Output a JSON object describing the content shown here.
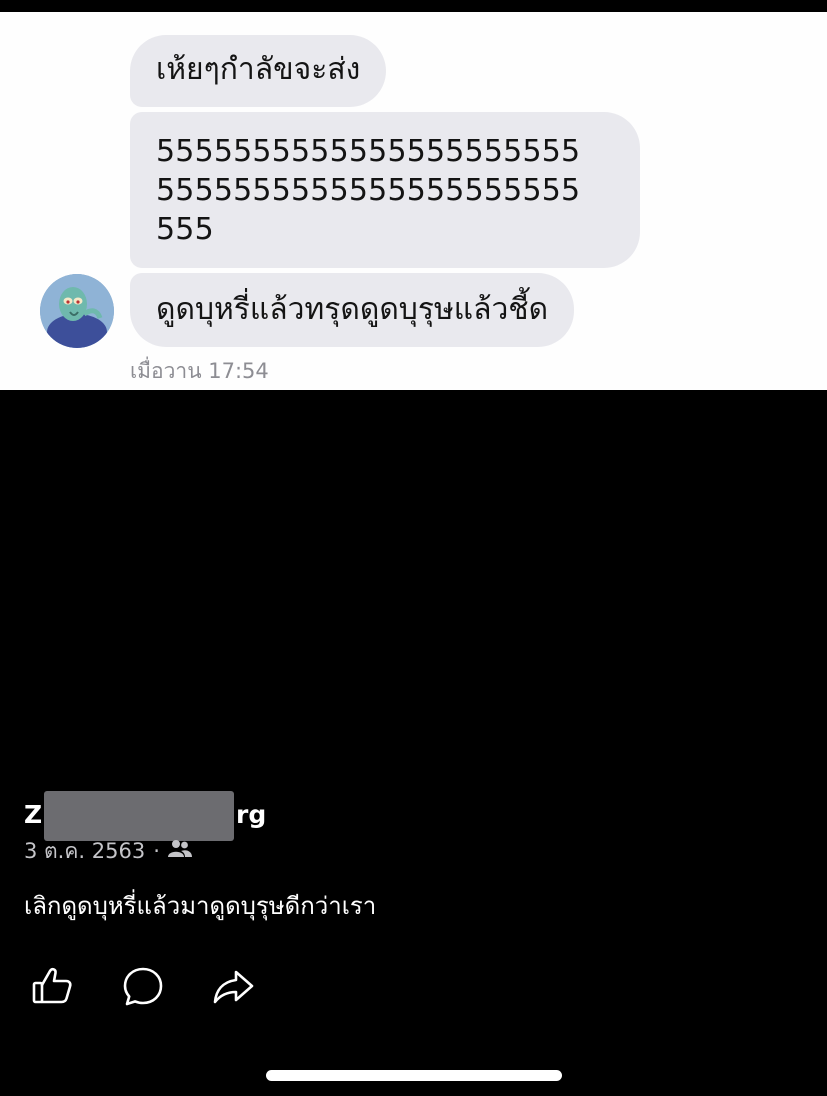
{
  "chat": {
    "messages": [
      {
        "lines": [
          "เห้ยๆกำลัขจะส่ง"
        ]
      },
      {
        "lines": [
          "5555555555555555555555",
          "5555555555555555555555",
          "555"
        ]
      },
      {
        "lines": [
          "ดูดบุหรี่แล้วทรุดดูดบุรุษแล้วชี้ด"
        ]
      }
    ],
    "timestamp": "เมื่อวาน 17:54"
  },
  "post": {
    "author_start": "Z",
    "author_end": "rg",
    "date": "3 ต.ค. 2563",
    "separator": "·",
    "audience_icon": "friends-icon",
    "caption": "เลิกดูดบุหรี่แล้วมาดูดบุรุษดีกว่าเรา"
  },
  "actions": [
    {
      "icon": "like-icon"
    },
    {
      "icon": "comment-icon"
    },
    {
      "icon": "share-icon"
    }
  ],
  "colors": {
    "background": "#000000",
    "bubble": "#e9e9ee",
    "chat_background": "#fefefe",
    "meta_text": "#c4c4c8"
  }
}
